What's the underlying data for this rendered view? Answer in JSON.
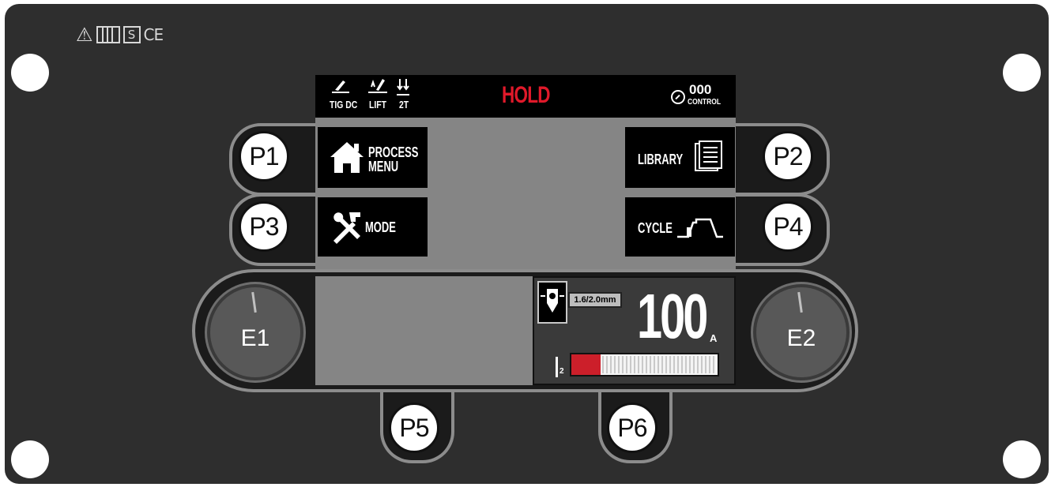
{
  "certification_marks": [
    "⚠",
    "S",
    "CE"
  ],
  "status_bar": {
    "process_label": "TIG DC",
    "start_label": "LIFT",
    "trigger_label": "2T",
    "hold_label": "HOLD",
    "control_value": "000",
    "control_label": "CONTROL"
  },
  "buttons": {
    "p1": "P1",
    "p2": "P2",
    "p3": "P3",
    "p4": "P4",
    "p5": "P5",
    "p6": "P6"
  },
  "encoders": {
    "e1": "E1",
    "e2": "E2"
  },
  "softkeys": {
    "process_menu_line1": "PROCESS",
    "process_menu_line2": "MENU",
    "library": "LIBRARY",
    "mode": "MODE",
    "cycle": "CYCLE"
  },
  "readout": {
    "electrode_size": "1.6/2.0mm",
    "current_value": "100",
    "current_unit": "A",
    "level_label": "2",
    "level_fraction": 0.2
  },
  "colors": {
    "panel": "#2e2e2e",
    "hold_red": "#e0192a",
    "bar_red": "#cc1f2a"
  },
  "icons": [
    "warning-icon",
    "manual-icon",
    "s-mark-icon",
    "home-icon",
    "tools-icon",
    "library-icon",
    "cycle-icon",
    "knob-icon",
    "electrode-icon"
  ]
}
